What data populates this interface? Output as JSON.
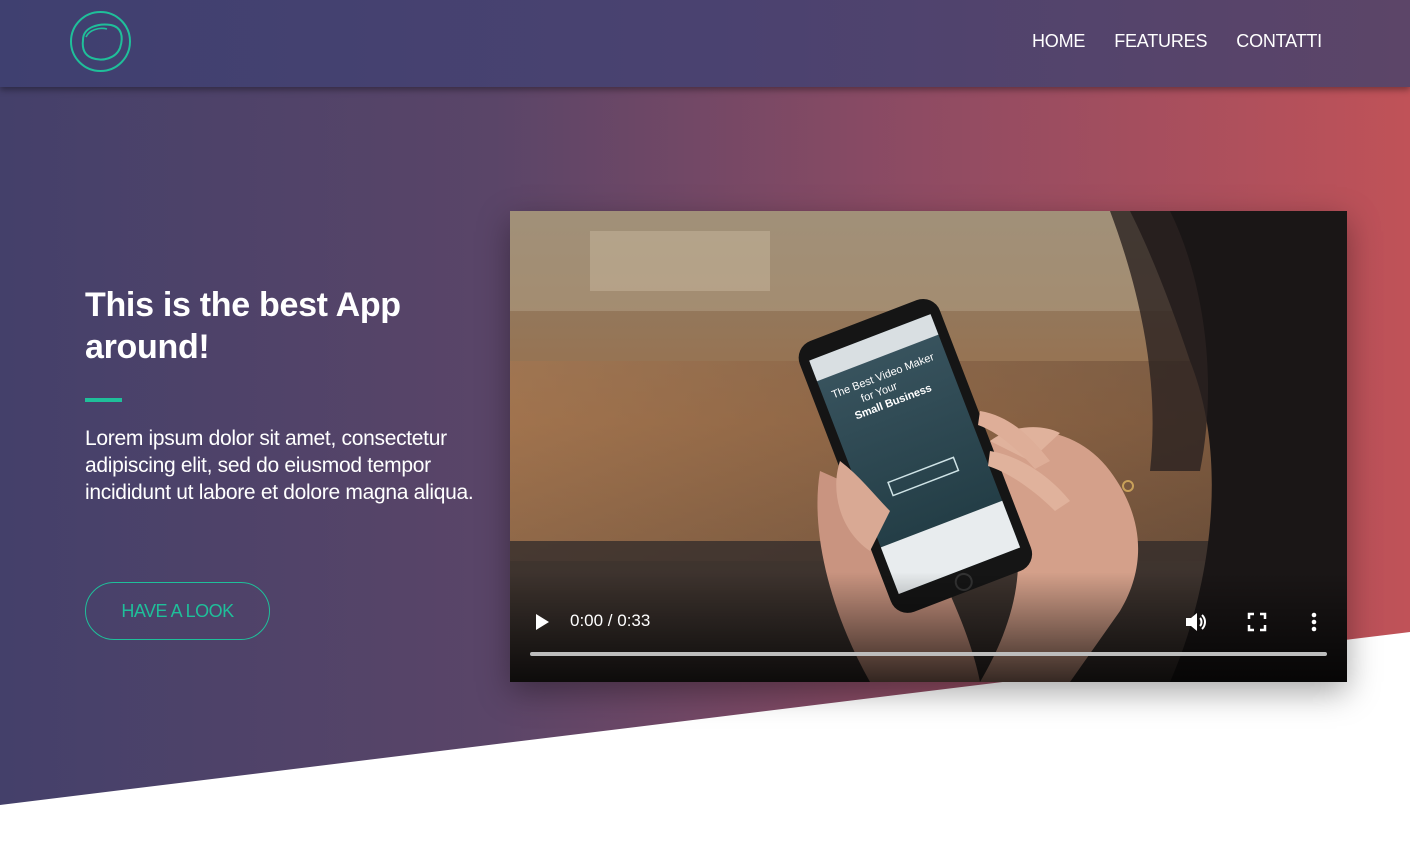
{
  "nav": {
    "logo": "logo-circle-icon",
    "items": [
      {
        "label": "HOME"
      },
      {
        "label": "FEATURES"
      },
      {
        "label": "CONTATTI"
      }
    ]
  },
  "hero": {
    "title_line1": "This is the best App",
    "title_line2": "around!",
    "body": "Lorem ipsum dolor sit amet, consectetur adipiscing elit, sed do eiusmod tempor incididunt ut labore et dolore magna aliqua.",
    "cta_label": "HAVE A LOOK"
  },
  "video": {
    "time": "0:00 / 0:33",
    "progress": 0,
    "icons": {
      "play": "play-icon",
      "volume": "volume-icon",
      "fullscreen": "fullscreen-icon",
      "more": "more-vertical-icon"
    },
    "phone_screen": {
      "heading_line1": "The Best Video Maker",
      "heading_line2": "for Your",
      "heading_line3": "Small Business"
    }
  },
  "colors": {
    "accent": "#1fbf9a",
    "gradient_start": "#44406a",
    "gradient_end": "#c05258",
    "navbar": "#45416f"
  }
}
